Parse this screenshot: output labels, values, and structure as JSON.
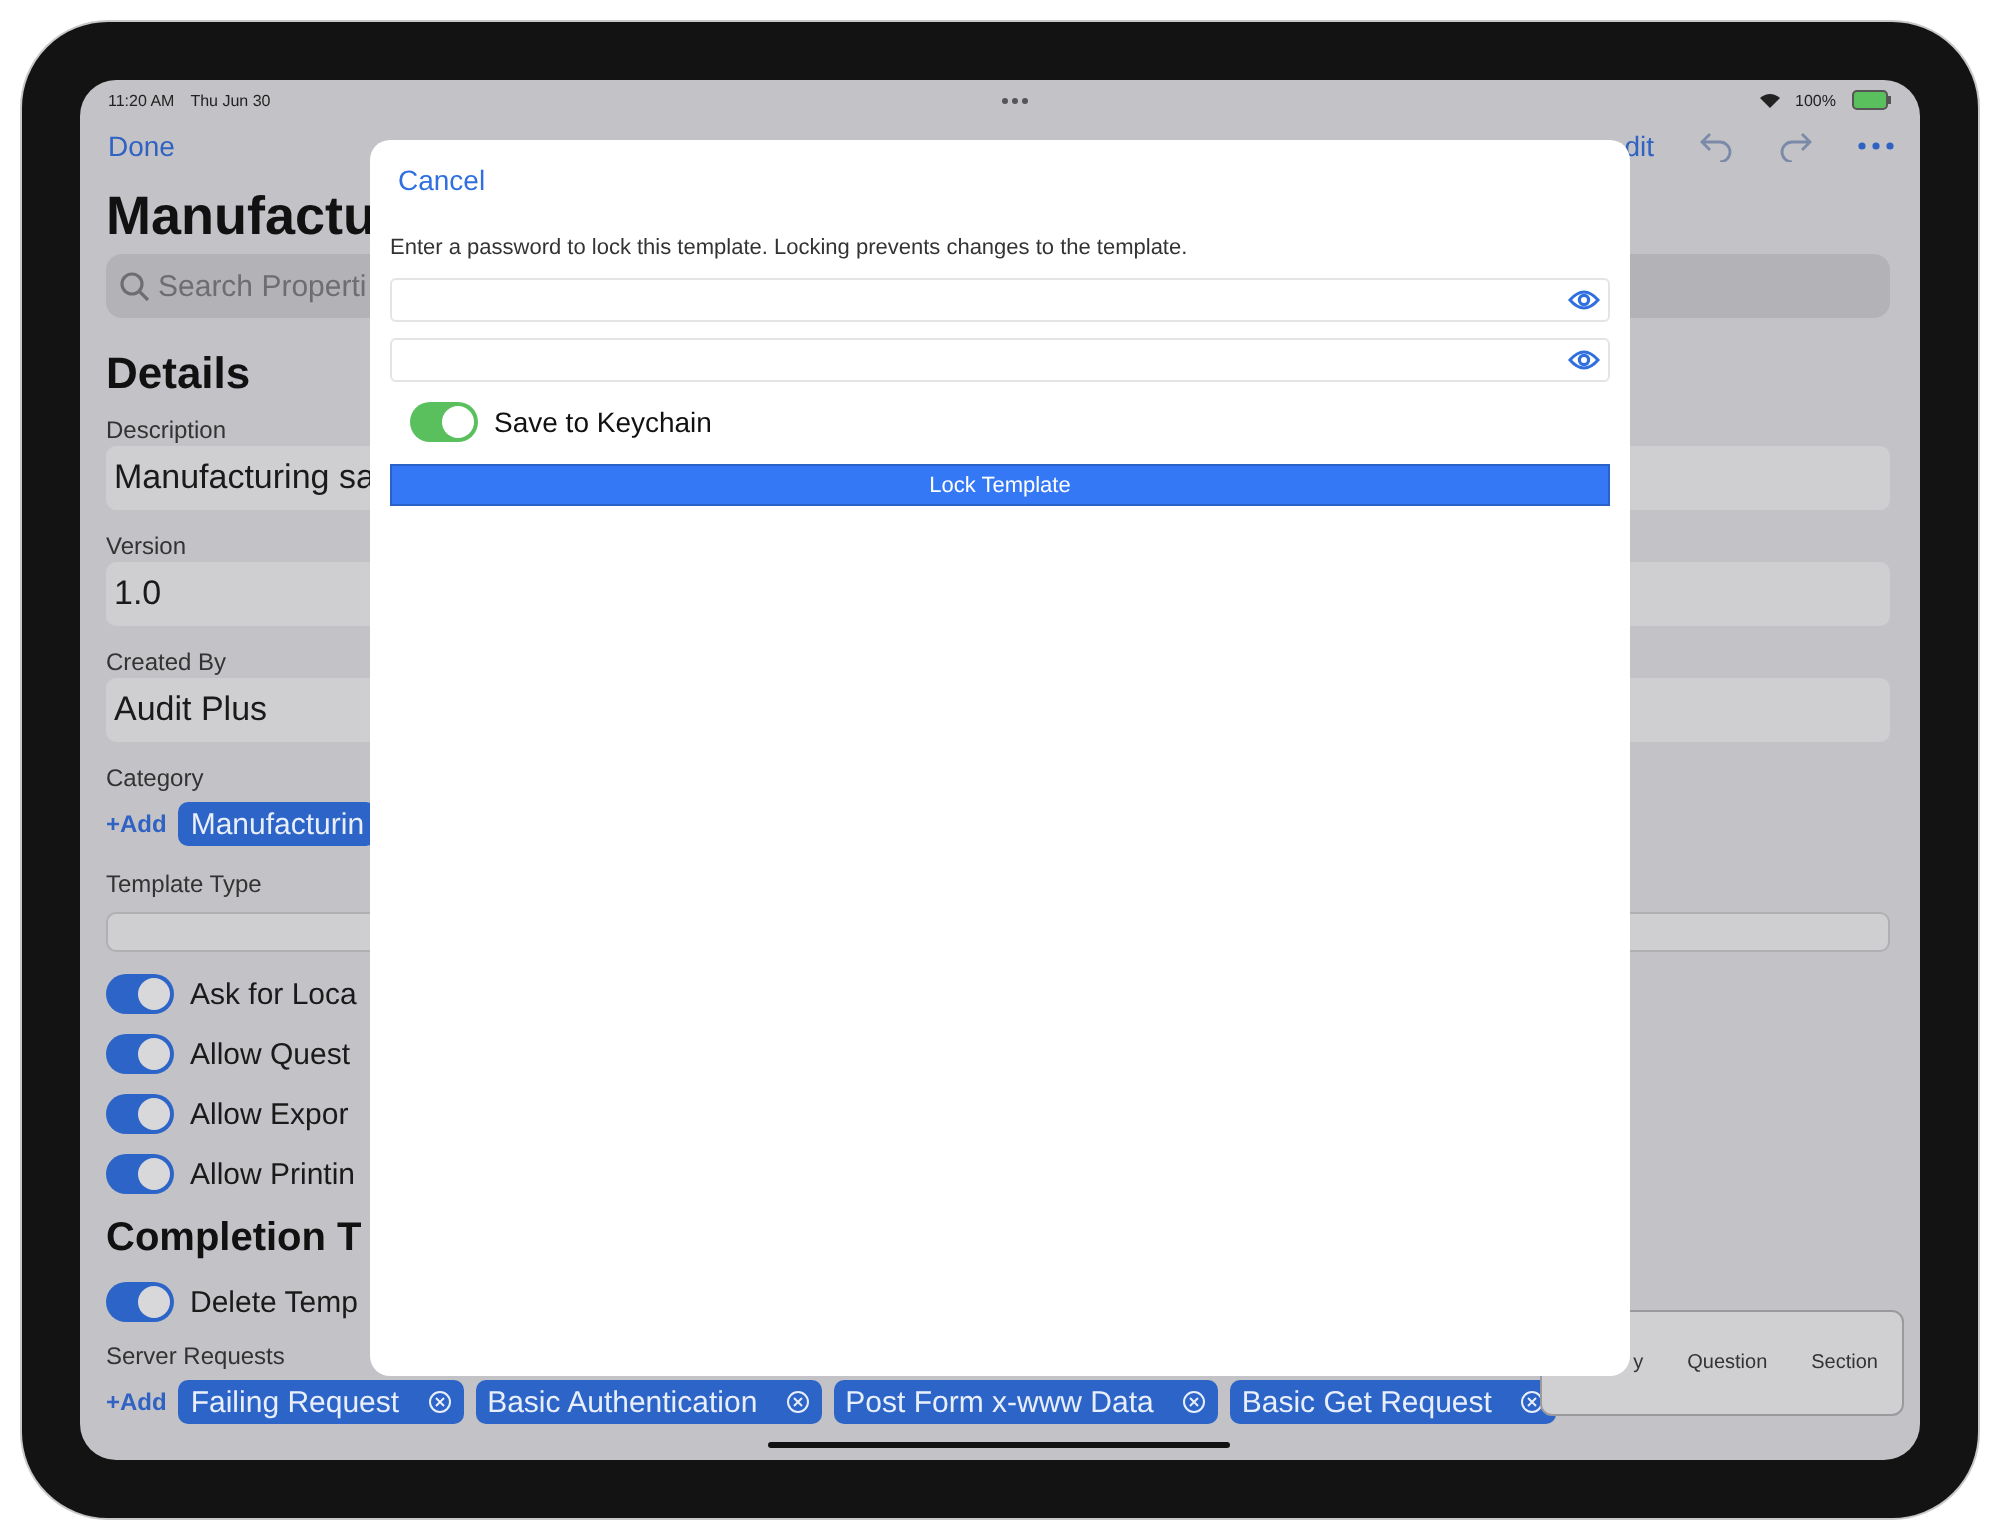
{
  "status_bar": {
    "time": "11:20 AM",
    "date": "Thu Jun 30",
    "battery": "100%"
  },
  "nav": {
    "done": "Done",
    "edit": "dit"
  },
  "page": {
    "title": "Manufactu",
    "search": {
      "placeholder": "Search Properti"
    },
    "details_heading": "Details",
    "fields": [
      {
        "label": "Description",
        "value": "Manufacturing sa"
      },
      {
        "label": "Version",
        "value": "1.0"
      },
      {
        "label": "Created By",
        "value": "Audit Plus"
      }
    ],
    "category": {
      "label": "Category",
      "add": "+Add",
      "chips": [
        "Manufacturin"
      ]
    },
    "template_type": {
      "label": "Template Type"
    },
    "toggles": [
      {
        "label": "Ask for Loca",
        "on": true
      },
      {
        "label": "Allow Quest",
        "on": true
      },
      {
        "label": "Allow Expor",
        "on": true
      },
      {
        "label": "Allow Printin",
        "on": true
      }
    ],
    "completion_heading": "Completion T",
    "completion_toggles": [
      {
        "label": "Delete Temp",
        "on": true
      }
    ],
    "server_requests": {
      "label": "Server Requests",
      "add": "+Add",
      "chips": [
        "Failing Request",
        "Basic Authentication",
        "Post Form x-www Data",
        "Basic Get Request"
      ]
    }
  },
  "insert_menu": {
    "items": [
      "y",
      "Question",
      "Section"
    ]
  },
  "modal": {
    "cancel": "Cancel",
    "message": "Enter a password to lock this template. Locking prevents changes to the template.",
    "password_fields": [
      {
        "kind": "secure"
      },
      {
        "kind": "secure"
      }
    ],
    "keychain": {
      "label": "Save to Keychain",
      "on": true
    },
    "button": "Lock Template"
  }
}
